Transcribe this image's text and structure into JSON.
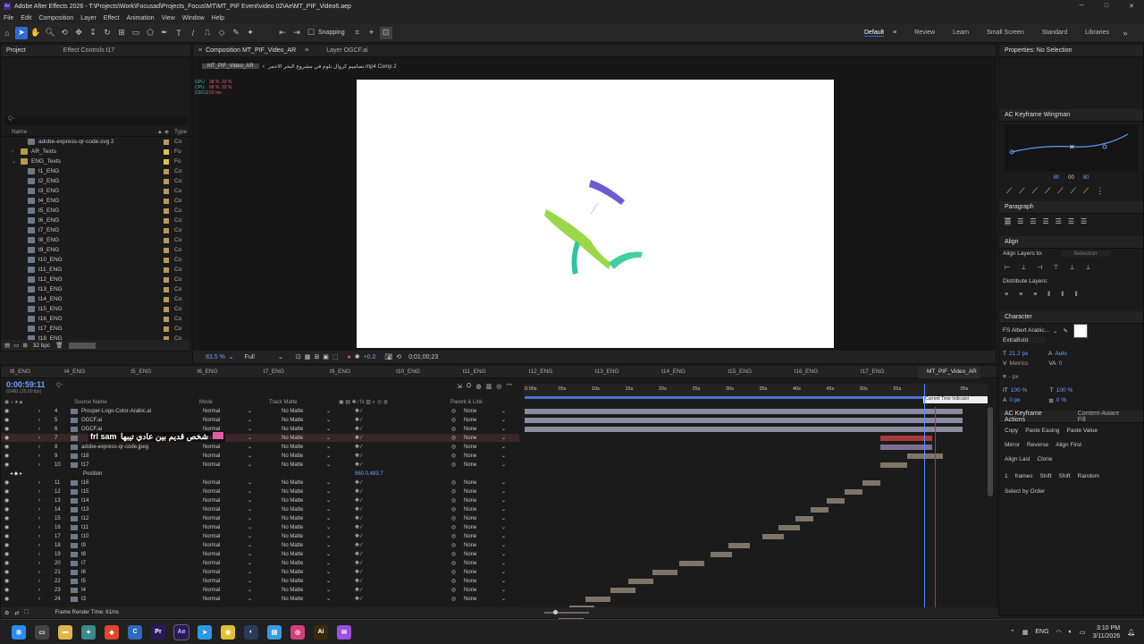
{
  "window": {
    "title": "Adobe After Effects 2026 - T:\\Projects\\Work\\Focusad\\Projects_Focus\\MT\\MT_PIF Event\\video 02\\Ae\\MT_PIF_Video6.aep"
  },
  "menu": [
    "File",
    "Edit",
    "Composition",
    "Layer",
    "Effect",
    "Animation",
    "View",
    "Window",
    "Help"
  ],
  "toolbar": {
    "snapping_label": "Snapping",
    "workspaces": [
      "Default",
      "Review",
      "Learn",
      "Small Screen",
      "Standard",
      "Libraries"
    ]
  },
  "project_panel": {
    "tabs": [
      "Project",
      "Effect Controls t17"
    ],
    "search_placeholder": "Q~",
    "col_name": "Name",
    "col_type": "Type",
    "items": [
      {
        "name": "adobe-express-qr-code.svg 2",
        "type": "Co",
        "kind": "file",
        "indent": 1,
        "color": "#b59b5a"
      },
      {
        "name": "AR_Texts",
        "type": "Fo",
        "kind": "folder",
        "indent": 0,
        "color": "#d8c34a"
      },
      {
        "name": "ENG_Texts",
        "type": "Fo",
        "kind": "folder",
        "indent": 0,
        "color": "#d8c34a"
      },
      {
        "name": "t1_ENG",
        "type": "Co",
        "kind": "file",
        "indent": 1,
        "color": "#b59b5a"
      },
      {
        "name": "t2_ENG",
        "type": "Co",
        "kind": "file",
        "indent": 1,
        "color": "#b59b5a"
      },
      {
        "name": "t3_ENG",
        "type": "Co",
        "kind": "file",
        "indent": 1,
        "color": "#b59b5a"
      },
      {
        "name": "t4_ENG",
        "type": "Co",
        "kind": "file",
        "indent": 1,
        "color": "#b59b5a"
      },
      {
        "name": "t5_ENG",
        "type": "Co",
        "kind": "file",
        "indent": 1,
        "color": "#b59b5a"
      },
      {
        "name": "t6_ENG",
        "type": "Co",
        "kind": "file",
        "indent": 1,
        "color": "#b59b5a"
      },
      {
        "name": "t7_ENG",
        "type": "Co",
        "kind": "file",
        "indent": 1,
        "color": "#b59b5a"
      },
      {
        "name": "t8_ENG",
        "type": "Co",
        "kind": "file",
        "indent": 1,
        "color": "#b59b5a"
      },
      {
        "name": "t9_ENG",
        "type": "Co",
        "kind": "file",
        "indent": 1,
        "color": "#b59b5a"
      },
      {
        "name": "t10_ENG",
        "type": "Co",
        "kind": "file",
        "indent": 1,
        "color": "#b59b5a"
      },
      {
        "name": "t11_ENG",
        "type": "Co",
        "kind": "file",
        "indent": 1,
        "color": "#b59b5a"
      },
      {
        "name": "t12_ENG",
        "type": "Co",
        "kind": "file",
        "indent": 1,
        "color": "#b59b5a"
      },
      {
        "name": "t13_ENG",
        "type": "Co",
        "kind": "file",
        "indent": 1,
        "color": "#b59b5a"
      },
      {
        "name": "t14_ENG",
        "type": "Co",
        "kind": "file",
        "indent": 1,
        "color": "#b59b5a"
      },
      {
        "name": "t15_ENG",
        "type": "Co",
        "kind": "file",
        "indent": 1,
        "color": "#b59b5a"
      },
      {
        "name": "t16_ENG",
        "type": "Co",
        "kind": "file",
        "indent": 1,
        "color": "#b59b5a"
      },
      {
        "name": "t17_ENG",
        "type": "Co",
        "kind": "file",
        "indent": 1,
        "color": "#b59b5a"
      },
      {
        "name": "t18_ENG",
        "type": "Co",
        "kind": "file",
        "indent": 1,
        "color": "#b59b5a"
      }
    ],
    "bit_depth": "32 bpc"
  },
  "viewer": {
    "tab_comp": "Composition MT_PIF_Video_AR",
    "tab_layer": "Layer OGCF.ai",
    "breadcrumb_active": "MT_PIF_Video_AR",
    "breadcrumb_other": "تصاميم كروال نلوم في مشروع البحر الاحمر.mp4 Comp 2",
    "zoom": "83.5 %",
    "resolution": "Full",
    "timecode": "0;01;00;23",
    "exposure": "+0.0",
    "perf": [
      [
        "GPU",
        "38 %",
        "22 %"
      ],
      [
        "CPU",
        "68 %",
        "33 %"
      ],
      [
        "D3D12",
        "32 ms",
        ""
      ]
    ]
  },
  "properties": {
    "title": "Properties: No Selection",
    "wingman_title": "AC Keyframe Wingman",
    "wingman_values": [
      "80",
      "00",
      "80"
    ],
    "paragraph_title": "Paragraph",
    "align_title": "Align",
    "align_layers_to": "Align Layers to:",
    "align_selection": "Selection",
    "distribute_layers": "Distribute Layers:",
    "character_title": "Character",
    "font_family": "FS Albert Arabic...",
    "font_style": "ExtraBold",
    "font_size": "21.2 px",
    "leading": "Auto",
    "kerning": "Metrics",
    "tracking": "0",
    "stroke": "- px",
    "vscale": "100 %",
    "hscale": "100 %",
    "baseline": "0 px",
    "tsume": "0 %",
    "actions_title": "AC Keyframe Actions",
    "content_aware": "Content-Aware Fill",
    "actions_row1": [
      "Copy",
      "Paste Easing",
      "Paste Value"
    ],
    "actions_row2": [
      "Mirror",
      "Reverse",
      "Align First"
    ],
    "actions_row3": [
      "Align Last",
      "Clone"
    ],
    "actions_row4": [
      "1",
      "frames",
      "Shift",
      "Shift",
      "Random"
    ],
    "select_by_order": "Select by Order"
  },
  "timeline": {
    "tabs": [
      "t8_ENG",
      "t4_ENG",
      "t5_ENG",
      "t6_ENG",
      "t7_ENG",
      "t9_ENG",
      "t10_ENG",
      "t11_ENG",
      "t12_ENG",
      "t13_ENG",
      "t14_ENG",
      "t15_ENG",
      "t16_ENG",
      "t17_ENG",
      "MT_PIF_Video_AR"
    ],
    "current_time": "0:00:59:11",
    "fps_info": "01481 (25.00 fps)",
    "col_source": "Source Name",
    "col_mode": "Mode",
    "col_track": "Track Matte",
    "col_parent": "Parent & Link",
    "ruler": [
      "0:00s",
      "05s",
      "10s",
      "15s",
      "20s",
      "25s",
      "30s",
      "35s",
      "40s",
      "45s",
      "50s",
      "55s",
      "",
      "05s"
    ],
    "tooltip": "Current Time Indicator",
    "position_label": "Position",
    "position_value": "960.0,483.7",
    "text_overlay": "frl sam",
    "arabic_overlay": "شخص قديم بين عادي تيبها",
    "layers": [
      {
        "num": "4",
        "name": "Prosper-Logo-Color-Arabic.ai",
        "mode": "Normal",
        "matte": "No Matte",
        "parent": "None"
      },
      {
        "num": "5",
        "name": "OGCF.ai",
        "mode": "Normal",
        "matte": "No Matte",
        "parent": "None"
      },
      {
        "num": "6",
        "name": "OGCF.ai",
        "mode": "Normal",
        "matte": "No Matte",
        "parent": "None"
      },
      {
        "num": "7",
        "name": "",
        "mode": "Normal",
        "matte": "No Matte",
        "parent": "None"
      },
      {
        "num": "8",
        "name": "adobe-express-qr-code.jpeg",
        "mode": "Normal",
        "matte": "No Matte",
        "parent": "None"
      },
      {
        "num": "9",
        "name": "t18",
        "mode": "Normal",
        "matte": "No Matte",
        "parent": "None"
      },
      {
        "num": "10",
        "name": "t17",
        "mode": "Normal",
        "matte": "No Matte",
        "parent": "None"
      },
      {
        "num": "11",
        "name": "t16",
        "mode": "Normal",
        "matte": "No Matte",
        "parent": "None"
      },
      {
        "num": "12",
        "name": "t15",
        "mode": "Normal",
        "matte": "No Matte",
        "parent": "None"
      },
      {
        "num": "13",
        "name": "t14",
        "mode": "Normal",
        "matte": "No Matte",
        "parent": "None"
      },
      {
        "num": "14",
        "name": "t13",
        "mode": "Normal",
        "matte": "No Matte",
        "parent": "None"
      },
      {
        "num": "15",
        "name": "t12",
        "mode": "Normal",
        "matte": "No Matte",
        "parent": "None"
      },
      {
        "num": "16",
        "name": "t11",
        "mode": "Normal",
        "matte": "No Matte",
        "parent": "None"
      },
      {
        "num": "17",
        "name": "t10",
        "mode": "Normal",
        "matte": "No Matte",
        "parent": "None"
      },
      {
        "num": "18",
        "name": "t9",
        "mode": "Normal",
        "matte": "No Matte",
        "parent": "None"
      },
      {
        "num": "19",
        "name": "t8",
        "mode": "Normal",
        "matte": "No Matte",
        "parent": "None"
      },
      {
        "num": "20",
        "name": "t7",
        "mode": "Normal",
        "matte": "No Matte",
        "parent": "None"
      },
      {
        "num": "21",
        "name": "t6",
        "mode": "Normal",
        "matte": "No Matte",
        "parent": "None"
      },
      {
        "num": "22",
        "name": "t5",
        "mode": "Normal",
        "matte": "No Matte",
        "parent": "None"
      },
      {
        "num": "23",
        "name": "t4",
        "mode": "Normal",
        "matte": "No Matte",
        "parent": "None"
      },
      {
        "num": "24",
        "name": "t3",
        "mode": "Normal",
        "matte": "No Matte",
        "parent": "None"
      }
    ],
    "render_time": "Frame Render Time: 61ms"
  },
  "taskbar": {
    "apps": [
      "windows-icon",
      "explorer-window-icon",
      "folder-icon",
      "copilot-icon",
      "brave-icon",
      "c-app-icon",
      "premiere-icon",
      "aftereffects-icon",
      "telegram-icon",
      "chrome-icon",
      "steam-icon",
      "notepad-icon",
      "instagram-icon",
      "illustrator-icon",
      "messenger-icon"
    ],
    "lang": "ENG",
    "time": "3:10 PM",
    "date": "3/11/2026"
  }
}
